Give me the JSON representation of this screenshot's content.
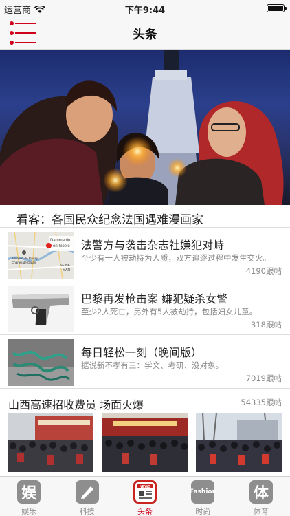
{
  "status_bar": {
    "carrier": "运营商",
    "time": "下午9:44"
  },
  "nav": {
    "title": "头条"
  },
  "hero": {
    "caption": "看客：各国民众纪念法国遇难漫画家"
  },
  "news": [
    {
      "title": "法警方与袭击杂志社嫌犯对峙",
      "desc": "至少有一人被劫持为人质，双方追逐过程中发生交火。",
      "count": "4190跟帖",
      "thumb_labels": [
        "Dammartin",
        "en-Goële",
        "Aéroport de Roissy",
        "Charles de Gaulle",
        "SEINE",
        "MAR"
      ]
    },
    {
      "title": "巴黎再发枪击案 嫌犯疑杀女警",
      "desc": "至少2人死亡，另外有5人被劫持，包括妇女儿童。",
      "count": "318跟帖"
    },
    {
      "title": "每日轻松一刻（晚间版）",
      "desc": "据说新不孝有三：学文、考研、没对象。",
      "count": "7019跟帖"
    }
  ],
  "group": {
    "title": "山西高速招收费员 场面火爆",
    "count": "54335跟帖"
  },
  "tabs": [
    {
      "label": "娱乐",
      "glyph": "娱",
      "icon": "entertainment-icon"
    },
    {
      "label": "科技",
      "glyph": "",
      "icon": "tech-icon"
    },
    {
      "label": "头条",
      "glyph": "NEWS",
      "icon": "headline-icon"
    },
    {
      "label": "时尚",
      "glyph": "Fashion",
      "icon": "fashion-icon"
    },
    {
      "label": "体育",
      "glyph": "体",
      "icon": "sports-icon"
    }
  ],
  "colors": {
    "accent": "#d0021b",
    "tab_inactive": "#8e8e8e",
    "muted_text": "#8a8a8a"
  }
}
